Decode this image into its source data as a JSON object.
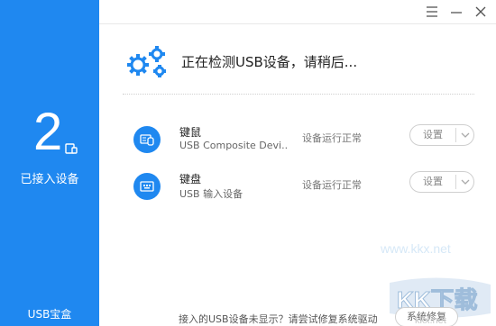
{
  "sidebar": {
    "count": "2",
    "caption": "已接入设备",
    "footer": "USB宝盒",
    "color": "#1f88f0"
  },
  "window": {
    "menu_icon": "menu-icon",
    "minimize_icon": "minimize-icon",
    "close_icon": "close-icon"
  },
  "header": {
    "icon": "gears-icon",
    "title": "正在检测USB设备，请稍后..."
  },
  "devices": [
    {
      "icon": "mouse-keyboard-icon",
      "name": "键鼠",
      "description": "USB Composite Devi...",
      "status": "设备运行正常",
      "settings_label": "设置"
    },
    {
      "icon": "keyboard-icon",
      "name": "键盘",
      "description": "USB 输入设备",
      "status": "设备运行正常",
      "settings_label": "设置"
    }
  ],
  "footer": {
    "prompt": "接入的USB设备未显示？请尝试修复系统驱动",
    "repair_button": "系统修复"
  },
  "watermark": {
    "url": "www.kkx.net",
    "url_small": "kkx.net",
    "logo_text": "KK下载"
  }
}
